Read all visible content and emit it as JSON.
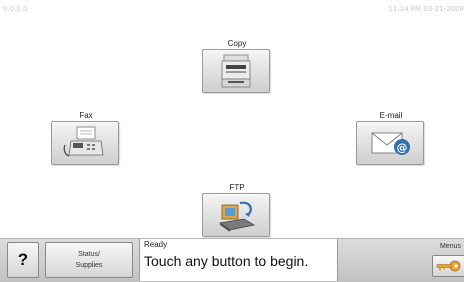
{
  "status_bar": {
    "ip_address": "0.0.0.0",
    "datetime": "11:14 PM 03-21-2008"
  },
  "functions": {
    "copy": {
      "label": "Copy",
      "icon": "copier-icon"
    },
    "fax": {
      "label": "Fax",
      "icon": "fax-machine-icon"
    },
    "email": {
      "label": "E-mail",
      "icon": "envelope-at-icon"
    },
    "ftp": {
      "label": "FTP",
      "icon": "ftp-transfer-icon"
    }
  },
  "bottom_bar": {
    "help_label": "?",
    "status_supplies_line1": "Status/",
    "status_supplies_line2": "Supplies",
    "message_status": "Ready",
    "message_text": "Touch any button to begin.",
    "menus_label": "Menus",
    "menus_icon": "key-icon"
  },
  "colors": {
    "accent_blue": "#2f6fb0",
    "key_gold": "#e8a23a"
  }
}
